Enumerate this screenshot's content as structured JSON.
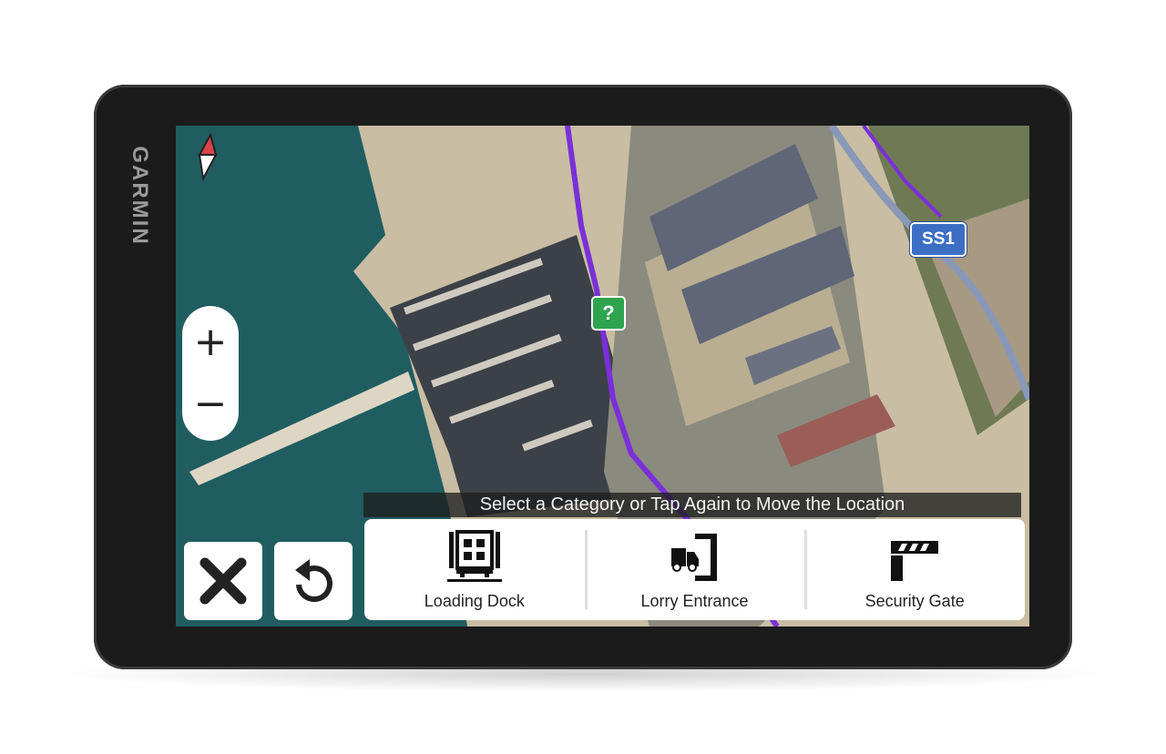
{
  "device": {
    "brand": "GARMIN"
  },
  "map": {
    "route_color": "#7b2fd9",
    "poi_marker": {
      "label": "?",
      "icon": "unknown-location-icon",
      "color": "#2ea44f"
    },
    "road_shield": {
      "label": "SS1",
      "color": "#3c6fc4"
    },
    "compass_icon": "north-arrow-icon"
  },
  "controls": {
    "zoom_in": "+",
    "zoom_out": "−",
    "cancel_icon": "close-icon",
    "reset_icon": "rotate-ccw-icon"
  },
  "prompt": "Select a Category or Tap Again to Move the Location",
  "categories": [
    {
      "label": "Loading Dock",
      "icon": "loading-dock-icon"
    },
    {
      "label": "Lorry Entrance",
      "icon": "lorry-entrance-icon"
    },
    {
      "label": "Security Gate",
      "icon": "security-gate-icon"
    }
  ]
}
